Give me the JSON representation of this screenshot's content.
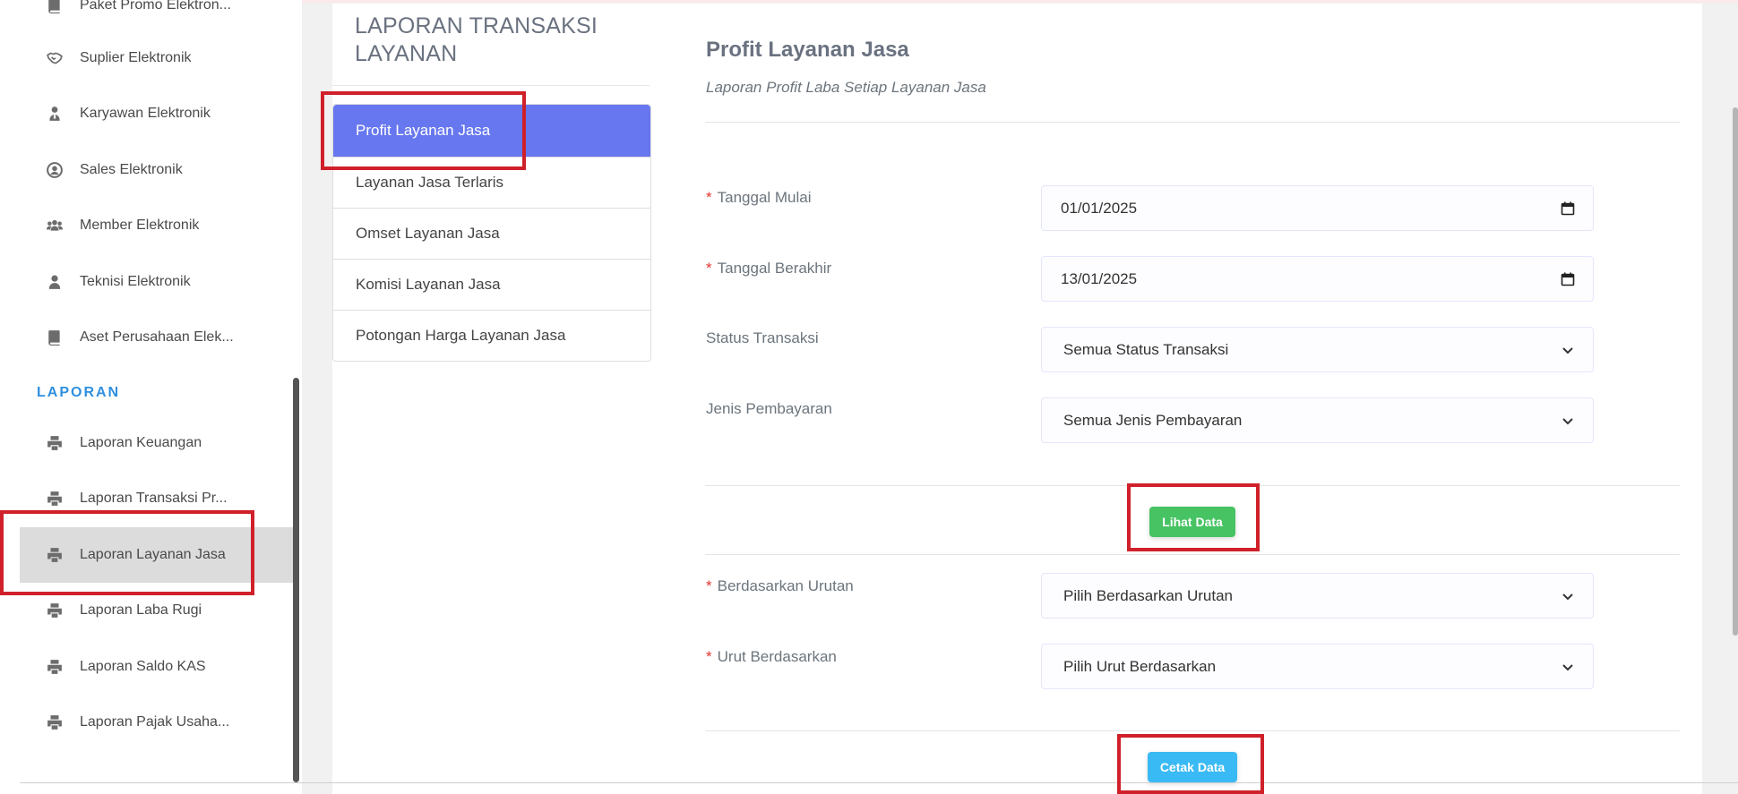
{
  "sidebar": {
    "items": [
      {
        "label": "Paket Promo Elektron...",
        "icon": "book-icon"
      },
      {
        "label": "Suplier Elektronik",
        "icon": "handshake-icon"
      },
      {
        "label": "Karyawan Elektronik",
        "icon": "user-tie-icon"
      },
      {
        "label": "Sales Elektronik",
        "icon": "user-circle-icon"
      },
      {
        "label": "Member Elektronik",
        "icon": "users-icon"
      },
      {
        "label": "Teknisi Elektronik",
        "icon": "user-icon"
      },
      {
        "label": "Aset Perusahaan Elek...",
        "icon": "book-icon"
      }
    ],
    "section_title": "LAPORAN",
    "report_items": [
      {
        "label": "Laporan Keuangan",
        "icon": "printer-icon"
      },
      {
        "label": "Laporan Transaksi Pr...",
        "icon": "printer-icon"
      },
      {
        "label": "Laporan Layanan Jasa",
        "icon": "printer-icon",
        "active": true
      },
      {
        "label": "Laporan Laba Rugi",
        "icon": "printer-icon"
      },
      {
        "label": "Laporan Saldo KAS",
        "icon": "printer-icon"
      },
      {
        "label": "Laporan Pajak Usaha...",
        "icon": "printer-icon"
      }
    ]
  },
  "panel": {
    "title": "LAPORAN TRANSAKSI LAYANAN",
    "tabs": [
      {
        "label": "Profit Layanan Jasa",
        "active": true
      },
      {
        "label": "Layanan Jasa Terlaris"
      },
      {
        "label": "Omset Layanan Jasa"
      },
      {
        "label": "Komisi Layanan Jasa"
      },
      {
        "label": "Potongan Harga Layanan Jasa"
      }
    ]
  },
  "content": {
    "title": "Profit Layanan Jasa",
    "subtitle": "Laporan Profit Laba Setiap Layanan Jasa",
    "required_mark": "*",
    "fields": {
      "start_date": {
        "label": "Tanggal Mulai",
        "value": "01/01/2025"
      },
      "end_date": {
        "label": "Tanggal Berakhir",
        "value": "13/01/2025"
      },
      "status": {
        "label": "Status Transaksi",
        "value": "Semua Status Transaksi"
      },
      "payment": {
        "label": "Jenis Pembayaran",
        "value": "Semua Jenis Pembayaran"
      },
      "order_by": {
        "label": "Berdasarkan Urutan",
        "value": "Pilih Berdasarkan Urutan"
      },
      "sort_by": {
        "label": "Urut Berdasarkan",
        "value": "Pilih Urut Berdasarkan"
      }
    },
    "view_button": "Lihat Data",
    "print_button": "Cetak Data"
  },
  "colors": {
    "accent": "#6777ef",
    "section": "#2f8fe0",
    "success": "#47c363",
    "info": "#3abaf4",
    "highlight": "#d0202a"
  }
}
